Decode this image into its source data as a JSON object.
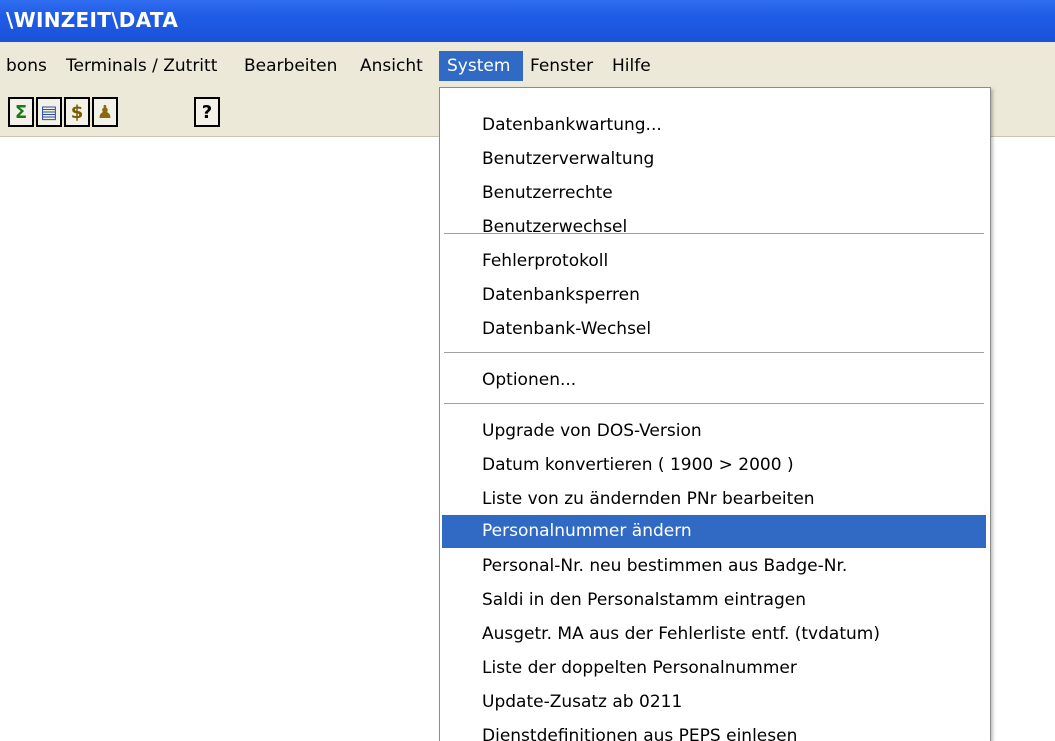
{
  "window": {
    "title": "\\WINZEIT\\DATA"
  },
  "menubar": {
    "items": [
      {
        "label": "bons"
      },
      {
        "label": "Terminals / Zutritt"
      },
      {
        "label": "Bearbeiten"
      },
      {
        "label": "Ansicht"
      },
      {
        "label": "System"
      },
      {
        "label": "Fenster"
      },
      {
        "label": "Hilfe"
      }
    ],
    "active": "System"
  },
  "toolbar": {
    "buttons": [
      {
        "icon": "sigma-icon",
        "glyph": "Σ"
      },
      {
        "icon": "report-icon",
        "glyph": "▤"
      },
      {
        "icon": "dollar-icon",
        "glyph": "$"
      },
      {
        "icon": "people-icon",
        "glyph": "♟"
      },
      {
        "icon": "help-icon",
        "glyph": "?"
      }
    ]
  },
  "system_menu": {
    "highlight_color": "#316ac5",
    "items": [
      {
        "label": "Datenbankwartung..."
      },
      {
        "label": "Benutzerverwaltung"
      },
      {
        "label": "Benutzerrechte"
      },
      {
        "label": "Benutzerwechsel"
      },
      {
        "label": "Fehlerprotokoll"
      },
      {
        "label": "Datenbanksperren"
      },
      {
        "label": "Datenbank-Wechsel"
      },
      {
        "label": "Optionen..."
      },
      {
        "label": "Upgrade von DOS-Version"
      },
      {
        "label": "Datum konvertieren ( 1900 > 2000 )"
      },
      {
        "label": "Liste von zu ändernden PNr bearbeiten"
      },
      {
        "label": "Personalnummer ändern"
      },
      {
        "label": "Personal-Nr. neu bestimmen aus Badge-Nr."
      },
      {
        "label": "Saldi in den Personalstamm eintragen"
      },
      {
        "label": "Ausgetr. MA aus der Fehlerliste entf. (tvdatum)"
      },
      {
        "label": "Liste der doppelten Personalnummer"
      },
      {
        "label": "Update-Zusatz ab 0211"
      },
      {
        "label": "Dienstdefinitionen aus PEPS einlesen"
      }
    ],
    "highlighted": "Personalnummer ändern"
  }
}
